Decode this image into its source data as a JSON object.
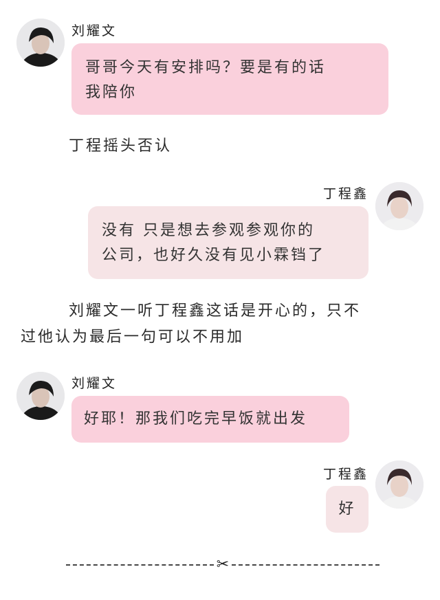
{
  "messages": [
    {
      "sender": "刘耀文",
      "text_lines": [
        "哥哥今天有安排吗？要是有的话",
        "我陪你"
      ]
    },
    {
      "sender": "丁程鑫",
      "text_lines": [
        "没有 只是想去参观参观你的",
        "公司，也好久没有见小霖铛了"
      ]
    },
    {
      "sender": "刘耀文",
      "text_lines": [
        "好耶！那我们吃完早饭就出发"
      ]
    },
    {
      "sender": "丁程鑫",
      "text_lines": [
        "好"
      ]
    }
  ],
  "narration": [
    {
      "lines": [
        "丁程摇头否认"
      ]
    },
    {
      "lines": [
        "刘耀文一听丁程鑫这话是开心的，只不",
        "过他认为最后一句可以不用加"
      ]
    }
  ],
  "colors": {
    "left_bubble": "#fad0dc",
    "right_bubble": "#f6e4e6"
  },
  "divider_icon": "scissors-icon"
}
